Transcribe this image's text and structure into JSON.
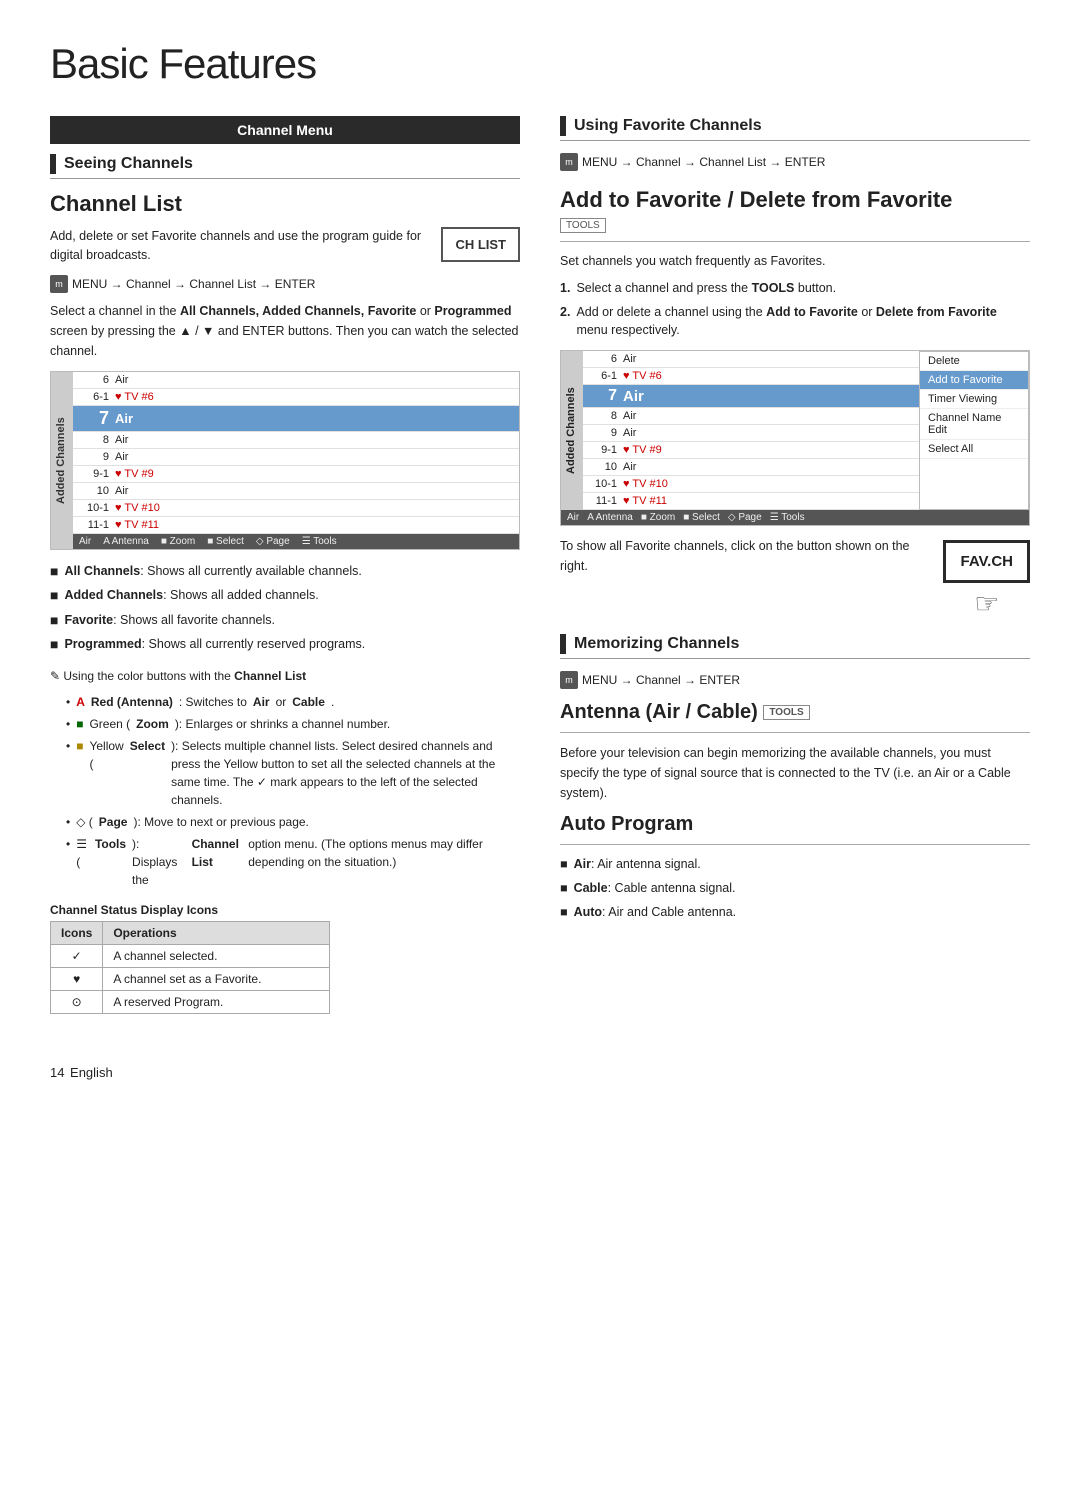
{
  "page": {
    "title": "Basic Features",
    "page_number": "14",
    "page_label": "English"
  },
  "left_col": {
    "channel_menu_bar": "Channel Menu",
    "seeing_channels_title": "Seeing Channels",
    "channel_list": {
      "title": "Channel List",
      "description": "Add, delete or set Favorite channels and use the program guide for digital broadcasts.",
      "ch_list_button": "CH LIST",
      "menu_path": "MENU  → Channel → Channel List → ENTER",
      "select_info_1": "Select a channel in the ",
      "select_info_bold": "All Channels, Added Channels, Favorite",
      "select_info_2": " or ",
      "select_info_bold2": "Programmed",
      "select_info_3": " screen by pressing the ▲ / ▼ and ENTER  buttons. Then you can watch the selected channel.",
      "mockup": {
        "sidebar_label": "Added Channels",
        "rows": [
          {
            "num": "6",
            "sub": "6-1",
            "name": "Air",
            "extra": "♥ TV #6",
            "highlighted": false
          },
          {
            "num": "7",
            "sub": "",
            "name": "Air",
            "extra": "",
            "highlighted": true
          },
          {
            "num": "8",
            "sub": "",
            "name": "Air",
            "extra": "",
            "highlighted": false
          },
          {
            "num": "9",
            "sub": "",
            "name": "Air",
            "extra": "",
            "highlighted": false
          },
          {
            "num": "9-1",
            "sub": "",
            "name": "",
            "extra": "♥ TV #9",
            "highlighted": false
          },
          {
            "num": "10",
            "sub": "",
            "name": "Air",
            "extra": "",
            "highlighted": false
          },
          {
            "num": "10-1",
            "sub": "",
            "name": "",
            "extra": "♥ TV #10",
            "highlighted": false
          },
          {
            "num": "11-1",
            "sub": "",
            "name": "",
            "extra": "♥ TV #11",
            "highlighted": false
          }
        ],
        "status_bar": "Air   A Antenna   ■ Zoom   ■ Select   ◇ Page   ☰ Tools"
      }
    },
    "bullets": [
      {
        "icon": "■",
        "text_bold": "All Channels",
        "text": ": Shows all currently available channels."
      },
      {
        "icon": "■",
        "text_bold": "Added Channels",
        "text": ": Shows all added channels."
      },
      {
        "icon": "■",
        "text_bold": "Favorite",
        "text": ": Shows all favorite channels."
      },
      {
        "icon": "■",
        "text_bold": "Programmed",
        "text": ": Shows all currently reserved programs."
      }
    ],
    "note_title": "✎ Using the color buttons with the Channel List",
    "sub_bullets": [
      {
        "color": "Red",
        "label": "Red (Antenna)",
        "text": ": Switches to ",
        "bold": "Air",
        "text2": " or ",
        "bold2": "Cable",
        "text3": "."
      },
      {
        "color": "Green",
        "label": "Green (Zoom)",
        "text": ": Enlarges or shrinks a channel number."
      },
      {
        "color": "Yellow",
        "label": "Yellow (Select)",
        "text": ": Selects multiple channel lists. Select desired channels and press the Yellow button to set all the selected channels at the same time. The ✓ mark appears to the left of the selected channels."
      },
      {
        "color": "Diamond",
        "label": "◇ (Page)",
        "text": ": Move to next or previous page."
      },
      {
        "color": "Tools",
        "label": "☰ (Tools)",
        "text": ": Displays the ",
        "bold": "Channel List",
        "text2": " option menu. (The options menus may differ depending on the situation.)"
      }
    ],
    "status_table": {
      "title": "Channel Status Display Icons",
      "headers": [
        "Icons",
        "Operations"
      ],
      "rows": [
        {
          "icon": "✓",
          "operation": "A channel selected."
        },
        {
          "icon": "♥",
          "operation": "A channel set as a Favorite."
        },
        {
          "icon": "⊙",
          "operation": "A reserved Program."
        }
      ]
    }
  },
  "right_col": {
    "using_fav_title": "Using Favorite Channels",
    "using_fav_menu": "MENU  → Channel → Channel List → ENTER",
    "add_fav_title": "Add to Favorite / Delete from Favorite",
    "tools_badge": "TOOLS",
    "fav_description": "Set channels you watch frequently as Favorites.",
    "steps": [
      {
        "num": "1.",
        "text": "Select a channel and press the TOOLS button."
      },
      {
        "num": "2.",
        "text": "Add or delete a channel using the Add to Favorite or Delete from Favorite menu respectively."
      }
    ],
    "fav_mockup": {
      "sidebar_label": "Added Channels",
      "rows": [
        {
          "num": "6",
          "sub": "6-1",
          "name": "Air",
          "extra": "♥ TV #6",
          "highlighted": false
        },
        {
          "num": "7",
          "sub": "",
          "name": "Air",
          "extra": "",
          "highlighted": true
        },
        {
          "num": "8",
          "sub": "",
          "name": "Air",
          "extra": "",
          "highlighted": false
        },
        {
          "num": "9",
          "sub": "",
          "name": "Air",
          "extra": "",
          "highlighted": false
        },
        {
          "num": "9-1",
          "sub": "",
          "name": "",
          "extra": "♥ TV #9",
          "highlighted": false
        },
        {
          "num": "10",
          "sub": "",
          "name": "Air",
          "extra": "",
          "highlighted": false
        },
        {
          "num": "10-1",
          "sub": "",
          "name": "",
          "extra": "♥ TV #10",
          "highlighted": false
        },
        {
          "num": "11-1",
          "sub": "",
          "name": "",
          "extra": "♥ TV #11",
          "highlighted": false
        }
      ],
      "context_menu": [
        "Delete",
        "Add to Favorite",
        "Timer Viewing",
        "Channel Name Edit",
        "Select All"
      ],
      "selected_ctx": "Add to Favorite",
      "status_bar": "Air   A Antenna   ■ Zoom   ■ Select   ◇ Page   ☰ Tools"
    },
    "fav_button_label": "FAV.CH",
    "fav_show_text": "To show all Favorite channels, click on the button shown on the right.",
    "memorizing": {
      "title": "Memorizing Channels",
      "menu_path": "MENU  → Channel → ENTER"
    },
    "antenna": {
      "title": "Antenna (Air / Cable)",
      "tools_badge": "TOOLS",
      "description": "Before your television can begin memorizing the available channels, you must specify the type of signal source that is connected to the TV (i.e. an Air or a Cable system)."
    },
    "auto_program": {
      "title": "Auto Program",
      "items": [
        {
          "bold": "Air",
          "text": ": Air antenna signal."
        },
        {
          "bold": "Cable",
          "text": ": Cable antenna signal."
        },
        {
          "bold": "Auto",
          "text": ": Air and Cable antenna."
        }
      ]
    }
  }
}
